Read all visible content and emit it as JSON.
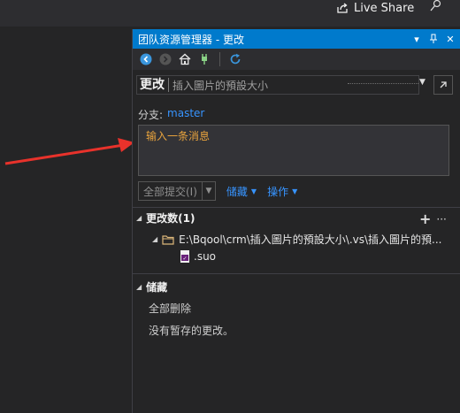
{
  "topbar": {
    "liveshare_label": "Live Share",
    "liveshare_icon": "share-icon",
    "pin_icon": "feedback-icon"
  },
  "panel": {
    "title": "团队资源管理器 - 更改",
    "nav_icons": [
      "back-icon",
      "forward-icon",
      "home-icon",
      "plug-icon",
      "refresh-icon"
    ]
  },
  "page": {
    "name": "更改",
    "context": "插入圖片的預設大小"
  },
  "branch": {
    "label": "分支:",
    "value": "master"
  },
  "message": {
    "placeholder": "输入一条消息"
  },
  "actions": {
    "commit_all": "全部提交(I)",
    "stash": "储藏",
    "actions": "操作"
  },
  "changes": {
    "header": "更改数(1)",
    "folder_path": "E:\\Bqool\\crm\\插入圖片的預設大小\\.vs\\插入圖片的預...",
    "file_name": ".suo"
  },
  "stashes": {
    "header": "储藏",
    "delete_all": "全部删除",
    "empty_message": "没有暂存的更改。"
  },
  "colors": {
    "accent": "#007acc",
    "link": "#3794ff",
    "placeholder": "#e8a33d",
    "annotation_arrow": "#e8322b"
  }
}
